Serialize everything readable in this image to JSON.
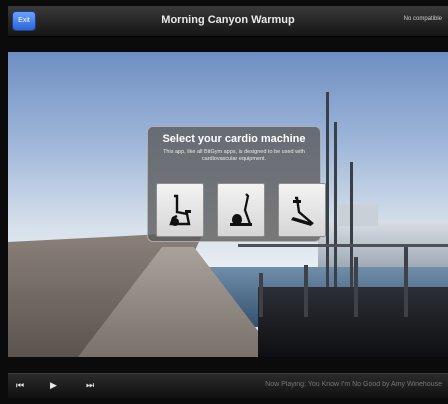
{
  "topbar": {
    "back_label": "Exit",
    "title": "Morning Canyon Warmup",
    "right_label": "No compatible"
  },
  "dialog": {
    "title": "Select your cardio machine",
    "subtitle": "This app, like all BitGym apps, is designed to be used with cardiovascular equipment.",
    "machines": [
      {
        "name": "exercise-bike",
        "icon": "bike-icon"
      },
      {
        "name": "elliptical",
        "icon": "elliptical-icon"
      },
      {
        "name": "treadmill",
        "icon": "treadmill-icon"
      }
    ]
  },
  "controls": {
    "rewind": "⏮",
    "play": "▶",
    "forward": "⏭",
    "now_playing": "Now Playing: You Know I'm No Good by Amy Winehouse"
  },
  "colors": {
    "accent": "#2c63d6",
    "dialog_bg": "#5a5a5a"
  }
}
